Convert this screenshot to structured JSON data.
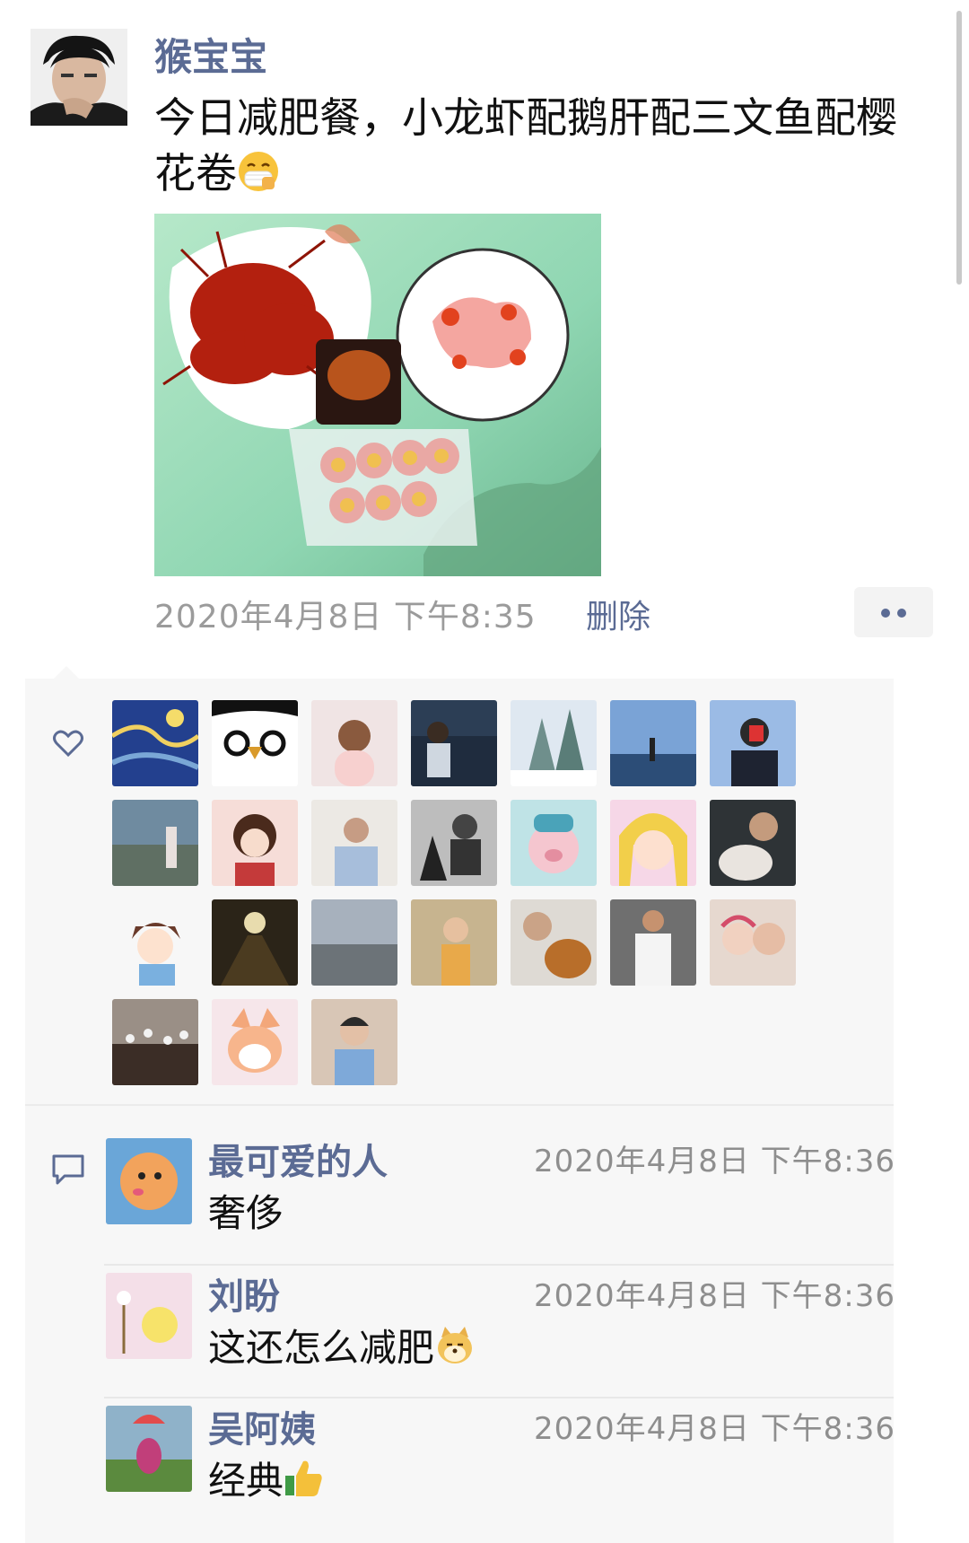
{
  "post": {
    "author": "猴宝宝",
    "text": "今日减肥餐，小龙虾配鹅肝配三文鱼配樱花卷",
    "text_emoji": "mask-face-emoji",
    "timestamp": "2020年4月8日 下午8:35",
    "delete_label": "删除",
    "more_icon": "more-dots-icon"
  },
  "likes": {
    "icon": "heart-icon",
    "count": 24
  },
  "comments_icon": "comment-icon",
  "comments": [
    {
      "name": "最可爱的人",
      "time": "2020年4月8日 下午8:36",
      "text": "奢侈",
      "emoji": ""
    },
    {
      "name": "刘盼",
      "time": "2020年4月8日 下午8:36",
      "text": "这还怎么减肥",
      "emoji": "doge-emoji"
    },
    {
      "name": "吴阿姨",
      "time": "2020年4月8日 下午8:36",
      "text": "经典",
      "emoji": "thumbs-up-emoji"
    }
  ],
  "colors": {
    "name_blue": "#5b6b94",
    "panel_bg": "#f7f7f7",
    "timestamp_gray": "#9b9b9b"
  }
}
